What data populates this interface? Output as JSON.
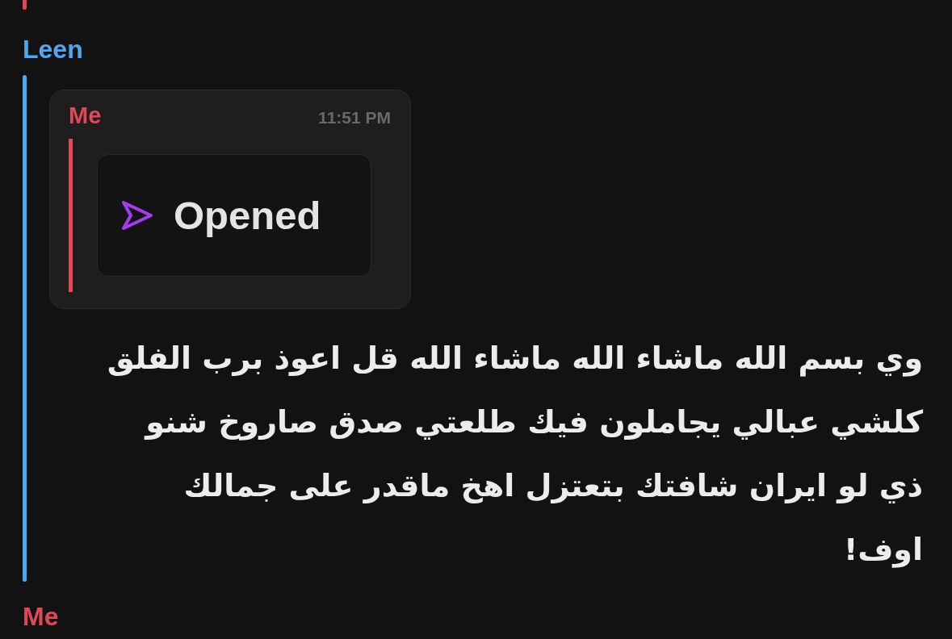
{
  "messages": [
    {
      "kind": "continued",
      "color": "#e0485a"
    },
    {
      "kind": "full",
      "sender": "Leen",
      "color": "#4ea8f0",
      "reply": {
        "sender": "Me",
        "color": "#e0485a",
        "time": "11:51 PM",
        "status": "Opened"
      },
      "text": "وي بسم الله ماشاء الله ماشاء الله قل اعوذ برب الفلق كلشي عبالي يجاملون فيك طلعتي صدق صاروخ شنو ذي لو ايران شافتك بتعتزل اهخ ماقدر على جمالك اوف!"
    },
    {
      "kind": "header",
      "sender": "Me",
      "color": "#e0485a"
    }
  ]
}
